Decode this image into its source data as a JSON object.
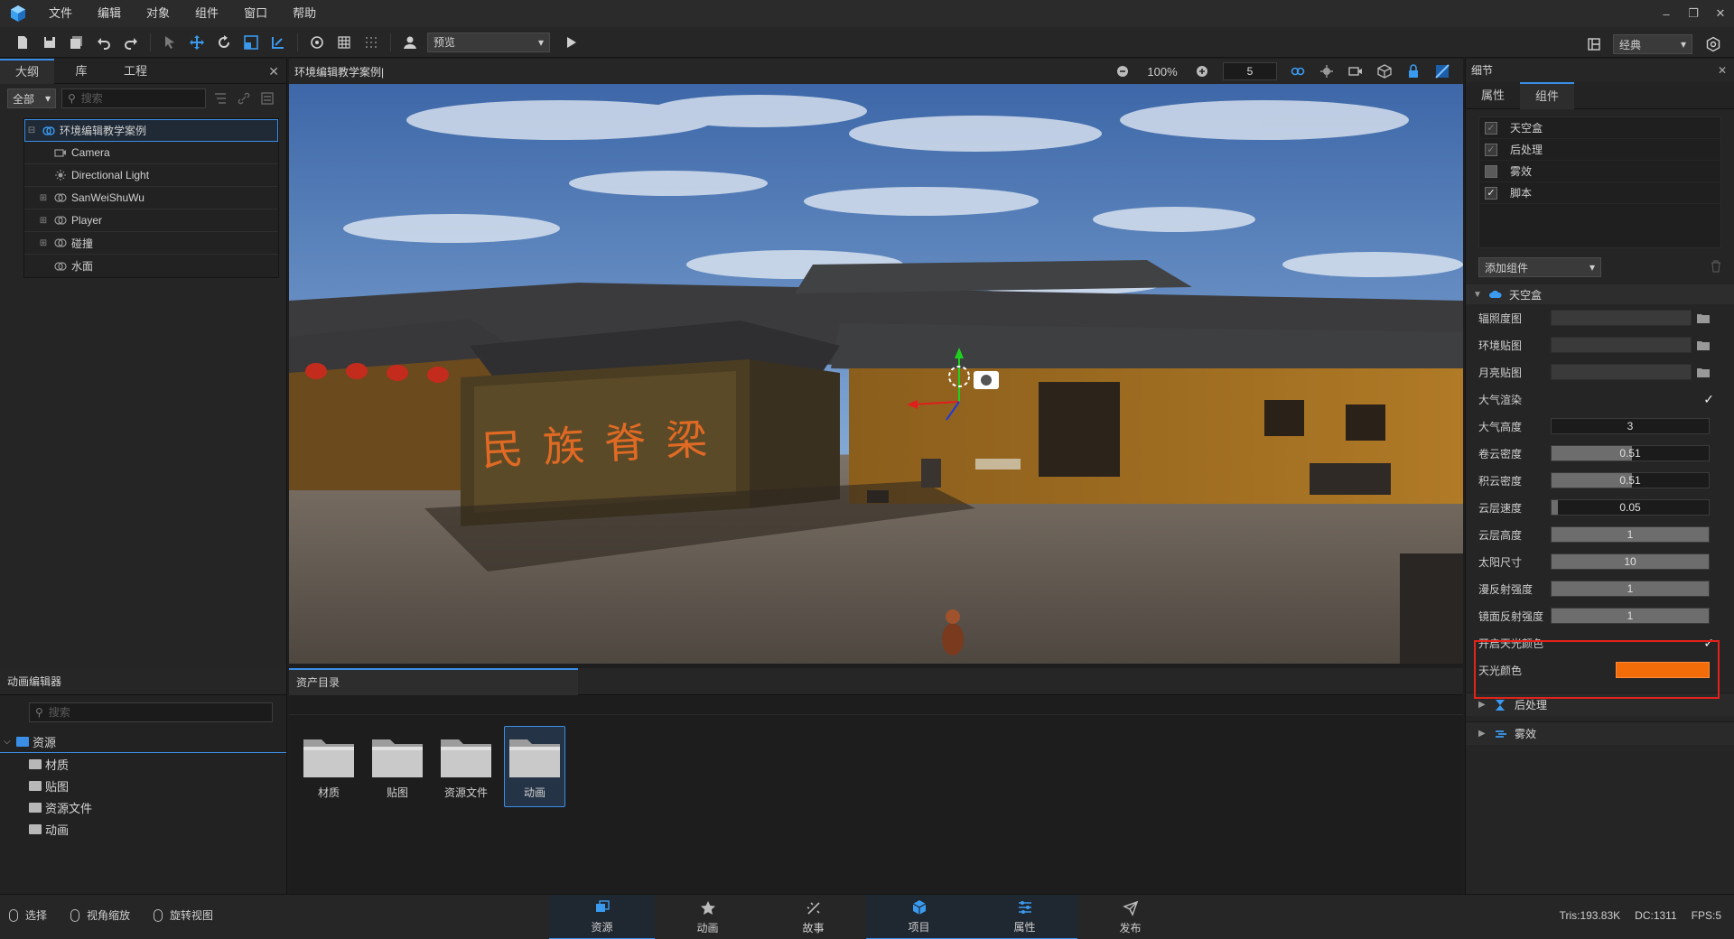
{
  "menu": [
    "文件",
    "编辑",
    "对象",
    "组件",
    "窗口",
    "帮助"
  ],
  "toolbar": {
    "preview_label": "预览",
    "layout_label": "经典",
    "icons": [
      "new-file-icon",
      "save-icon",
      "save-all-icon",
      "undo-icon",
      "redo-icon",
      "select-cursor-icon",
      "move-icon",
      "rotate-icon",
      "scale-icon",
      "transform-icon",
      "component-icon",
      "grid-icon",
      "dots-grid-icon",
      "user-icon",
      "play-icon"
    ]
  },
  "outline": {
    "tabs": [
      "大纲",
      "库",
      "工程"
    ],
    "filter_label": "全部",
    "search_placeholder": "搜索",
    "items": [
      {
        "label": "环境编辑教学案例",
        "icon": "group-icon"
      },
      {
        "label": "Camera",
        "icon": "camera-icon"
      },
      {
        "label": "Directional Light",
        "icon": "light-icon"
      },
      {
        "label": "SanWeiShuWu",
        "icon": "group-icon"
      },
      {
        "label": "Player",
        "icon": "group-icon"
      },
      {
        "label": "碰撞",
        "icon": "group-icon"
      },
      {
        "label": "水面",
        "icon": "group-icon"
      }
    ]
  },
  "viewport": {
    "title": "环境编辑教学案例|",
    "zoom": "100%",
    "grid_size": "5",
    "signboard_text": "民族脊梁"
  },
  "anim_editor": {
    "title": "动画编辑器",
    "search_placeholder": "搜索",
    "root": "资源",
    "children": [
      "材质",
      "贴图",
      "资源文件",
      "动画"
    ]
  },
  "assets": {
    "tab": "资产目录",
    "items": [
      "材质",
      "贴图",
      "资源文件",
      "动画"
    ],
    "selected_index": 3
  },
  "details": {
    "title": "细节",
    "tabs": [
      "属性",
      "组件"
    ],
    "components": [
      {
        "label": "天空盒",
        "checked": true,
        "dim": true
      },
      {
        "label": "后处理",
        "checked": true,
        "dim": true
      },
      {
        "label": "雾效",
        "checked": false,
        "dim": true
      },
      {
        "label": "脚本",
        "checked": true,
        "dim": false
      }
    ],
    "add_component_label": "添加组件",
    "section_sky": "天空盒",
    "props": {
      "irradiance_map": "辐照度图",
      "env_map": "环境贴图",
      "moon_map": "月亮贴图",
      "atmosphere_render": "大气渲染",
      "atmosphere_height_label": "大气高度",
      "atmosphere_height": "3",
      "cirrus_label": "卷云密度",
      "cirrus": "0.51",
      "cumulus_label": "积云密度",
      "cumulus": "0.51",
      "cloud_speed_label": "云层速度",
      "cloud_speed": "0.05",
      "cloud_height_label": "云层高度",
      "cloud_height": "1",
      "sun_size_label": "太阳尺寸",
      "sun_size": "10",
      "diffuse_label": "漫反射强度",
      "diffuse": "1",
      "specular_label": "镜面反射强度",
      "specular": "1",
      "enable_sky_color_label": "开启天光颜色",
      "sky_color_label": "天光颜色",
      "sky_color_value": "#f26d0a"
    },
    "section_post": "后处理",
    "section_fog": "雾效"
  },
  "status": {
    "hints": [
      "选择",
      "视角缩放",
      "旋转视图"
    ],
    "tabs": [
      {
        "label": "资源",
        "icon": "resources-icon"
      },
      {
        "label": "动画",
        "icon": "animation-icon"
      },
      {
        "label": "故事",
        "icon": "story-icon"
      },
      {
        "label": "项目",
        "icon": "project-icon"
      },
      {
        "label": "属性",
        "icon": "properties-icon"
      },
      {
        "label": "发布",
        "icon": "publish-icon"
      }
    ],
    "tris": "Tris:193.83K",
    "dc": "DC:1311",
    "fps": "FPS:5"
  },
  "colors": {
    "accent": "#3a8ee6",
    "highlight_border": "#e2231a",
    "sky_color": "#f26d0a"
  }
}
